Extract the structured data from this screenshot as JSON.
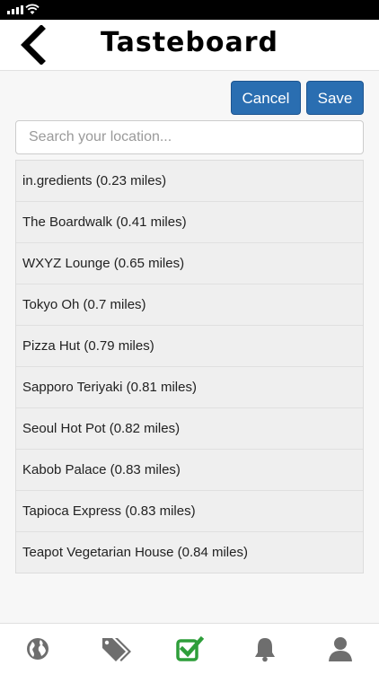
{
  "header": {
    "title": "Tasteboard"
  },
  "actions": {
    "cancel_label": "Cancel",
    "save_label": "Save"
  },
  "search": {
    "placeholder": "Search your location...",
    "value": ""
  },
  "locations": [
    "in.gredients (0.23 miles)",
    "The Boardwalk (0.41 miles)",
    "WXYZ Lounge (0.65 miles)",
    "Tokyo Oh (0.7 miles)",
    "Pizza Hut (0.79 miles)",
    "Sapporo Teriyaki (0.81 miles)",
    "Seoul Hot Pot (0.82 miles)",
    "Kabob Palace (0.83 miles)",
    "Tapioca Express (0.83 miles)",
    "Teapot Vegetarian House (0.84 miles)"
  ],
  "tabbar": {
    "items": [
      {
        "icon": "globe-icon",
        "active": false
      },
      {
        "icon": "tags-icon",
        "active": false
      },
      {
        "icon": "checkin-icon",
        "active": true
      },
      {
        "icon": "bell-icon",
        "active": false
      },
      {
        "icon": "user-icon",
        "active": false
      }
    ],
    "colors": {
      "inactive": "#6e6e6e",
      "active": "#2e9e3a"
    }
  },
  "colors": {
    "primary_button": "#2a6eb1"
  }
}
